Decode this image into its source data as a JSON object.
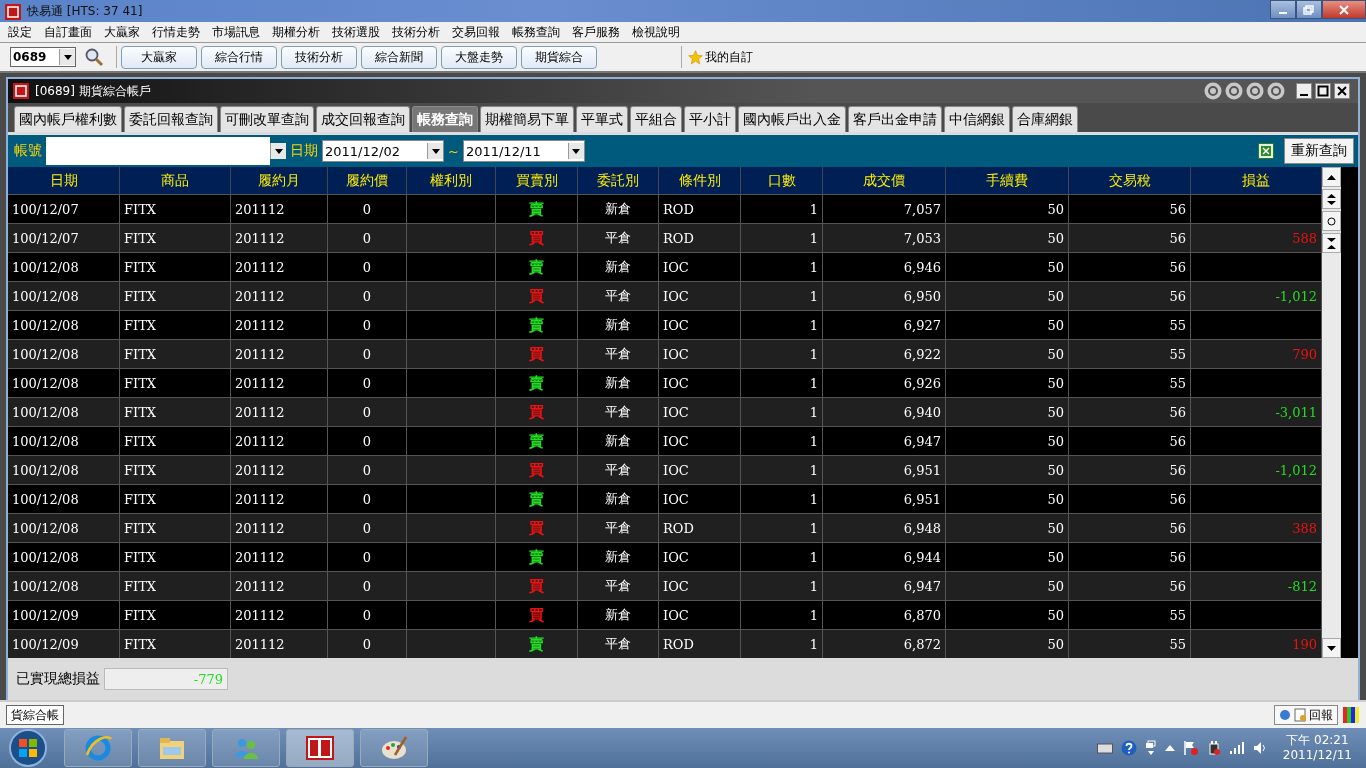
{
  "window": {
    "title": "快易通  [HTS: 37 41]"
  },
  "menu": [
    "設定",
    "自訂畫面",
    "大贏家",
    "行情走勢",
    "市場訊息",
    "期權分析",
    "技術選股",
    "技術分析",
    "交易回報",
    "帳務查詢",
    "客戶服務",
    "檢視說明"
  ],
  "toolbar": {
    "code": "0689",
    "buttons": [
      "大贏家",
      "綜合行情",
      "技術分析",
      "綜合新聞",
      "大盤走勢",
      "期貨綜合"
    ],
    "favorites": "我的自訂"
  },
  "subwindow": {
    "title": "[0689] 期貨綜合帳戶"
  },
  "tabs": [
    {
      "label": "國內帳戶權利數",
      "selected": false
    },
    {
      "label": "委託回報查詢",
      "selected": false
    },
    {
      "label": "可刪改單查詢",
      "selected": false
    },
    {
      "label": "成交回報查詢",
      "selected": false
    },
    {
      "label": "帳務查詢",
      "selected": true
    },
    {
      "label": "期權簡易下單",
      "selected": false
    },
    {
      "label": "平單式",
      "selected": false
    },
    {
      "label": "平組合",
      "selected": false
    },
    {
      "label": "平小計",
      "selected": false
    },
    {
      "label": "國內帳戶出入金",
      "selected": false
    },
    {
      "label": "客戶出金申請",
      "selected": false
    },
    {
      "label": "中信網銀",
      "selected": false
    },
    {
      "label": "合庫網銀",
      "selected": false
    }
  ],
  "filter": {
    "account_label": "帳號",
    "date_label": "日期",
    "date_from": "2011/12/02",
    "separator": "~",
    "date_to": "2011/12/11",
    "requery_button": "重新查詢"
  },
  "table": {
    "columns": [
      "日期",
      "商品",
      "履約月",
      "履約價",
      "權利別",
      "買賣別",
      "委託別",
      "條件別",
      "口數",
      "成交價",
      "手續費",
      "交易稅",
      "損益"
    ],
    "rows": [
      {
        "date": "100/12/07",
        "product": "FITX",
        "month": "201112",
        "strike": "0",
        "side": {
          "text": "賣",
          "color": "#22dd22"
        },
        "order": "新倉",
        "cond": "ROD",
        "qty": "1",
        "price": "7,057",
        "fee": "50",
        "tax": "56"
      },
      {
        "date": "100/12/07",
        "product": "FITX",
        "month": "201112",
        "strike": "0",
        "side": {
          "text": "買",
          "color": "#ee1111"
        },
        "order": "平倉",
        "cond": "ROD",
        "qty": "1",
        "price": "7,053",
        "fee": "50",
        "tax": "56",
        "pnl": {
          "text": "588",
          "color": "#ee1111"
        }
      },
      {
        "date": "100/12/08",
        "product": "FITX",
        "month": "201112",
        "strike": "0",
        "side": {
          "text": "賣",
          "color": "#22dd22"
        },
        "order": "新倉",
        "cond": "IOC",
        "qty": "1",
        "price": "6,946",
        "fee": "50",
        "tax": "56"
      },
      {
        "date": "100/12/08",
        "product": "FITX",
        "month": "201112",
        "strike": "0",
        "side": {
          "text": "買",
          "color": "#ee1111"
        },
        "order": "平倉",
        "cond": "IOC",
        "qty": "1",
        "price": "6,950",
        "fee": "50",
        "tax": "56",
        "pnl": {
          "text": "-1,012",
          "color": "#22dd22"
        }
      },
      {
        "date": "100/12/08",
        "product": "FITX",
        "month": "201112",
        "strike": "0",
        "side": {
          "text": "賣",
          "color": "#22dd22"
        },
        "order": "新倉",
        "cond": "IOC",
        "qty": "1",
        "price": "6,927",
        "fee": "50",
        "tax": "55"
      },
      {
        "date": "100/12/08",
        "product": "FITX",
        "month": "201112",
        "strike": "0",
        "side": {
          "text": "買",
          "color": "#ee1111"
        },
        "order": "平倉",
        "cond": "IOC",
        "qty": "1",
        "price": "6,922",
        "fee": "50",
        "tax": "55",
        "pnl": {
          "text": "790",
          "color": "#ee1111"
        }
      },
      {
        "date": "100/12/08",
        "product": "FITX",
        "month": "201112",
        "strike": "0",
        "side": {
          "text": "賣",
          "color": "#22dd22"
        },
        "order": "新倉",
        "cond": "IOC",
        "qty": "1",
        "price": "6,926",
        "fee": "50",
        "tax": "55"
      },
      {
        "date": "100/12/08",
        "product": "FITX",
        "month": "201112",
        "strike": "0",
        "side": {
          "text": "買",
          "color": "#ee1111"
        },
        "order": "平倉",
        "cond": "IOC",
        "qty": "1",
        "price": "6,940",
        "fee": "50",
        "tax": "56",
        "pnl": {
          "text": "-3,011",
          "color": "#22dd22"
        }
      },
      {
        "date": "100/12/08",
        "product": "FITX",
        "month": "201112",
        "strike": "0",
        "side": {
          "text": "賣",
          "color": "#22dd22"
        },
        "order": "新倉",
        "cond": "IOC",
        "qty": "1",
        "price": "6,947",
        "fee": "50",
        "tax": "56"
      },
      {
        "date": "100/12/08",
        "product": "FITX",
        "month": "201112",
        "strike": "0",
        "side": {
          "text": "買",
          "color": "#ee1111"
        },
        "order": "平倉",
        "cond": "IOC",
        "qty": "1",
        "price": "6,951",
        "fee": "50",
        "tax": "56",
        "pnl": {
          "text": "-1,012",
          "color": "#22dd22"
        }
      },
      {
        "date": "100/12/08",
        "product": "FITX",
        "month": "201112",
        "strike": "0",
        "side": {
          "text": "賣",
          "color": "#22dd22"
        },
        "order": "新倉",
        "cond": "IOC",
        "qty": "1",
        "price": "6,951",
        "fee": "50",
        "tax": "56"
      },
      {
        "date": "100/12/08",
        "product": "FITX",
        "month": "201112",
        "strike": "0",
        "side": {
          "text": "買",
          "color": "#ee1111"
        },
        "order": "平倉",
        "cond": "ROD",
        "qty": "1",
        "price": "6,948",
        "fee": "50",
        "tax": "56",
        "pnl": {
          "text": "388",
          "color": "#ee1111"
        }
      },
      {
        "date": "100/12/08",
        "product": "FITX",
        "month": "201112",
        "strike": "0",
        "side": {
          "text": "賣",
          "color": "#22dd22"
        },
        "order": "新倉",
        "cond": "IOC",
        "qty": "1",
        "price": "6,944",
        "fee": "50",
        "tax": "56"
      },
      {
        "date": "100/12/08",
        "product": "FITX",
        "month": "201112",
        "strike": "0",
        "side": {
          "text": "買",
          "color": "#ee1111"
        },
        "order": "平倉",
        "cond": "IOC",
        "qty": "1",
        "price": "6,947",
        "fee": "50",
        "tax": "56",
        "pnl": {
          "text": "-812",
          "color": "#22dd22"
        }
      },
      {
        "date": "100/12/09",
        "product": "FITX",
        "month": "201112",
        "strike": "0",
        "side": {
          "text": "買",
          "color": "#ee1111"
        },
        "order": "新倉",
        "cond": "IOC",
        "qty": "1",
        "price": "6,870",
        "fee": "50",
        "tax": "55"
      },
      {
        "date": "100/12/09",
        "product": "FITX",
        "month": "201112",
        "strike": "0",
        "side": {
          "text": "賣",
          "color": "#22dd22"
        },
        "order": "平倉",
        "cond": "ROD",
        "qty": "1",
        "price": "6,872",
        "fee": "50",
        "tax": "55",
        "pnl": {
          "text": "190",
          "color": "#ee1111"
        }
      }
    ]
  },
  "summary": {
    "label": "已實現總損益",
    "value": "-779"
  },
  "status_bar": {
    "window_tab": "貨綜合帳",
    "report_button": "回報"
  },
  "taskbar": {
    "clock_time": "下午 02:21",
    "clock_date": "2011/12/11"
  }
}
